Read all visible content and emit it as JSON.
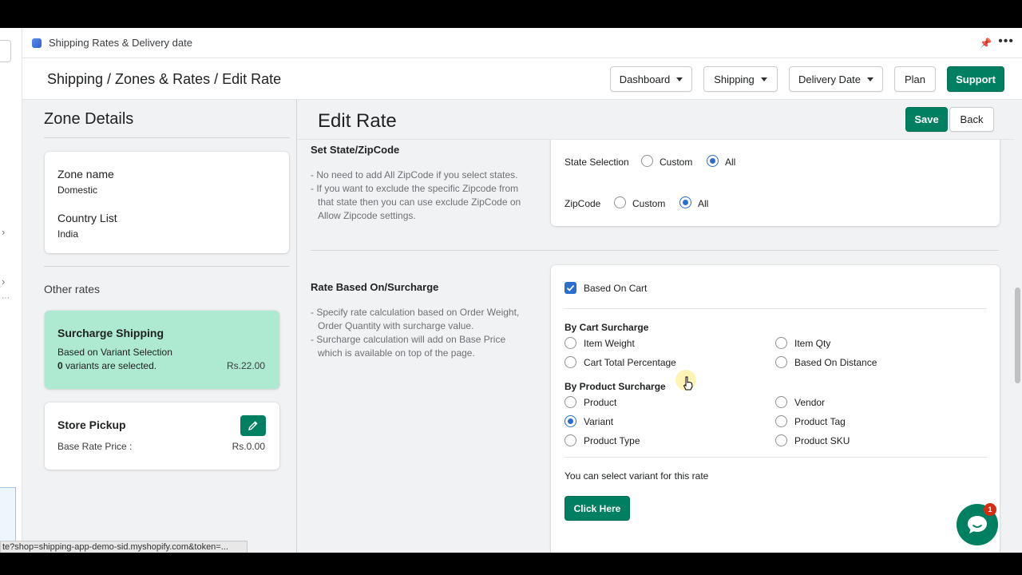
{
  "tab": {
    "title": "Shipping Rates & Delivery date"
  },
  "header": {
    "breadcrumb": "Shipping / Zones & Rates / Edit Rate",
    "nav": {
      "dashboard": "Dashboard",
      "shipping": "Shipping",
      "delivery_date": "Delivery Date",
      "plan": "Plan",
      "support": "Support"
    }
  },
  "zone": {
    "title": "Zone Details",
    "name_label": "Zone name",
    "name_value": "Domestic",
    "country_label": "Country List",
    "country_value": "India",
    "other_rates_label": "Other rates",
    "rates": [
      {
        "name": "Surcharge Shipping",
        "detail": "Based on Variant Selection",
        "count": "0",
        "count_suffix": " variants are selected.",
        "price": "Rs.22.00"
      },
      {
        "name": "Store Pickup",
        "detail": "Base Rate Price :",
        "price": "Rs.0.00"
      }
    ]
  },
  "edit": {
    "title": "Edit Rate",
    "save_label": "Save",
    "back_label": "Back",
    "state_section": {
      "title": "Set State/ZipCode",
      "help": [
        "- No need to add All ZipCode if you select states.",
        "- If you want to exclude the specific Zipcode from that state then you can use exclude ZipCode on Allow Zipcode settings."
      ],
      "state_label": "State Selection",
      "zip_label": "ZipCode",
      "opt_custom": "Custom",
      "opt_all": "All"
    },
    "rate_section": {
      "title": "Rate Based On/Surcharge",
      "help": [
        "- Specify rate calculation based on Order Weight, Order Quantity with surcharge value.",
        "- Surcharge calculation will add on Base Price which is available on top of the page."
      ],
      "based_on_cart": "Based On Cart",
      "cart_heading": "By Cart Surcharge",
      "cart_options": [
        "Item Weight",
        "Item Qty",
        "Cart Total Percentage",
        "Based On Distance"
      ],
      "product_heading": "By Product Surcharge",
      "product_options": [
        "Product",
        "Vendor",
        "Variant",
        "Product Tag",
        "Product Type",
        "Product SKU"
      ],
      "selected": "Variant",
      "variant_note": "You can select variant for this rate",
      "click_here": "Click Here"
    }
  },
  "status_url": "te?shop=shipping-app-demo-sid.myshopify.com&token=...",
  "chat_badge": "1",
  "colors": {
    "primary": "#008060",
    "radio": "#2c6ecb",
    "highlight_card": "#aee9d1"
  }
}
